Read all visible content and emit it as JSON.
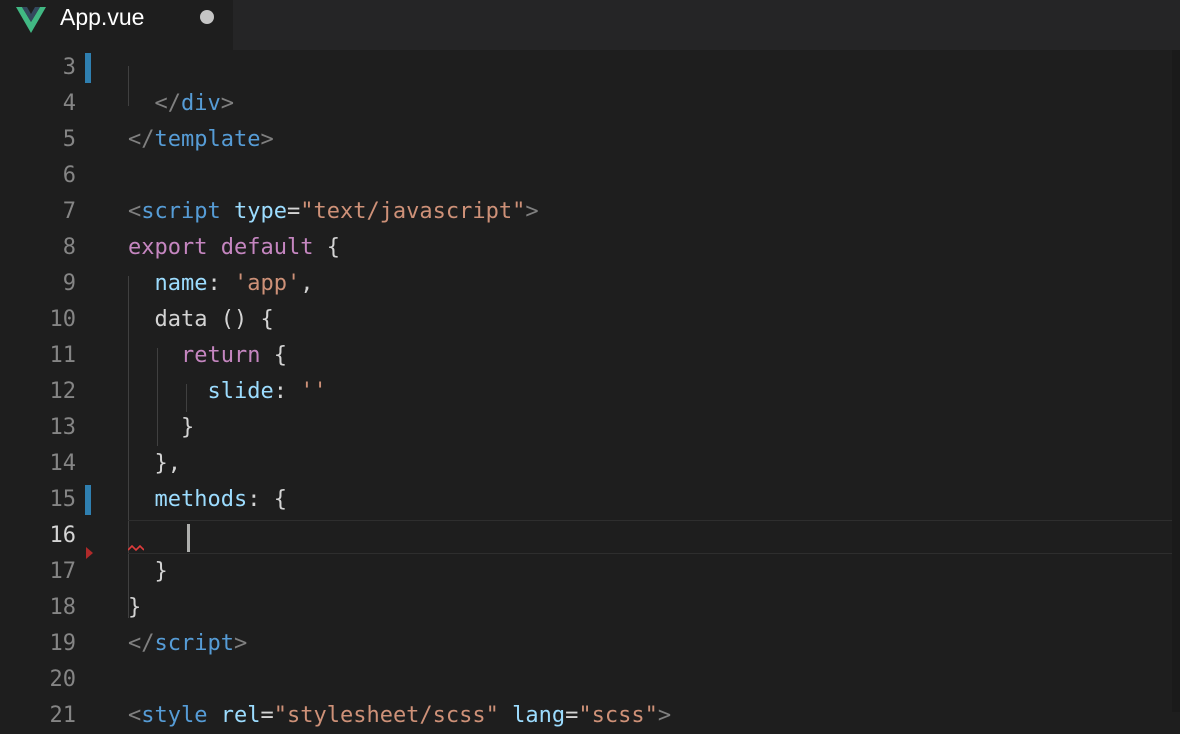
{
  "tab": {
    "title": "App.vue",
    "modified_indicator": "●"
  },
  "colors": {
    "background": "#1e1e1e",
    "tag": "#569cd6",
    "attribute": "#9cdcfe",
    "string": "#ce9178",
    "keyword": "#c586c0",
    "punctuation": "#808080",
    "vue_green": "#41b883",
    "vue_dark": "#34495e"
  },
  "icons": {
    "tab": "vue-logo-icon"
  },
  "editor": {
    "current_line": "16",
    "lines": [
      {
        "n": "3",
        "segments": []
      },
      {
        "n": "4",
        "segments": [
          [
            "  ",
            "text"
          ],
          [
            "</",
            "punct"
          ],
          [
            "div",
            "tag"
          ],
          [
            ">",
            "punct"
          ]
        ]
      },
      {
        "n": "5",
        "segments": [
          [
            "</",
            "punct"
          ],
          [
            "template",
            "tag"
          ],
          [
            ">",
            "punct"
          ]
        ]
      },
      {
        "n": "6",
        "segments": []
      },
      {
        "n": "7",
        "segments": [
          [
            "<",
            "punct"
          ],
          [
            "script",
            "tag"
          ],
          [
            " ",
            "text"
          ],
          [
            "type",
            "attr"
          ],
          [
            "=",
            "text"
          ],
          [
            "\"text/javascript\"",
            "str"
          ],
          [
            ">",
            "punct"
          ]
        ]
      },
      {
        "n": "8",
        "segments": [
          [
            "export",
            "kw"
          ],
          [
            " ",
            "text"
          ],
          [
            "default",
            "kw"
          ],
          [
            " {",
            "text"
          ]
        ]
      },
      {
        "n": "9",
        "segments": [
          [
            "  ",
            "text"
          ],
          [
            "name",
            "prop"
          ],
          [
            ": ",
            "text"
          ],
          [
            "'app'",
            "str"
          ],
          [
            ",",
            "text"
          ]
        ]
      },
      {
        "n": "10",
        "segments": [
          [
            "  data () {",
            "text"
          ]
        ]
      },
      {
        "n": "11",
        "segments": [
          [
            "    ",
            "text"
          ],
          [
            "return",
            "kw"
          ],
          [
            " {",
            "text"
          ]
        ]
      },
      {
        "n": "12",
        "segments": [
          [
            "      ",
            "text"
          ],
          [
            "slide",
            "prop"
          ],
          [
            ": ",
            "text"
          ],
          [
            "''",
            "str"
          ]
        ]
      },
      {
        "n": "13",
        "segments": [
          [
            "    }",
            "text"
          ]
        ]
      },
      {
        "n": "14",
        "segments": [
          [
            "  },",
            "text"
          ]
        ]
      },
      {
        "n": "15",
        "segments": [
          [
            "  ",
            "text"
          ],
          [
            "methods",
            "prop"
          ],
          [
            ": {",
            "text"
          ]
        ]
      },
      {
        "n": "16",
        "segments": []
      },
      {
        "n": "17",
        "segments": [
          [
            "  }",
            "text"
          ]
        ]
      },
      {
        "n": "18",
        "segments": [
          [
            "}",
            "text"
          ]
        ]
      },
      {
        "n": "19",
        "segments": [
          [
            "</",
            "punct"
          ],
          [
            "script",
            "tag"
          ],
          [
            ">",
            "punct"
          ]
        ]
      },
      {
        "n": "20",
        "segments": []
      },
      {
        "n": "21",
        "segments": [
          [
            "<",
            "punct"
          ],
          [
            "style",
            "tag"
          ],
          [
            " ",
            "text"
          ],
          [
            "rel",
            "attr"
          ],
          [
            "=",
            "text"
          ],
          [
            "\"stylesheet/scss\"",
            "str"
          ],
          [
            " ",
            "text"
          ],
          [
            "lang",
            "attr"
          ],
          [
            "=",
            "text"
          ],
          [
            "\"scss\"",
            "str"
          ],
          [
            ">",
            "punct"
          ]
        ]
      }
    ]
  }
}
